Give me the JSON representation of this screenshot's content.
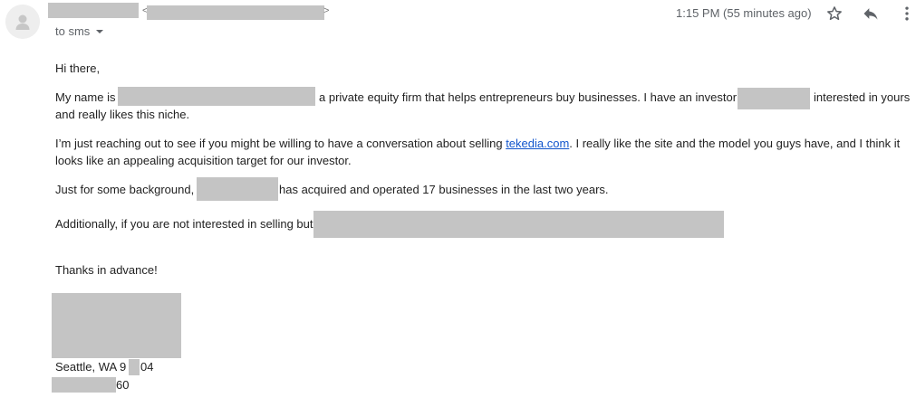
{
  "header": {
    "recipient_label": "to sms",
    "angle_open": "<",
    "angle_close": ">",
    "timestamp": "1:15 PM (55 minutes ago)"
  },
  "email": {
    "greeting": "Hi there,",
    "p1_start": "My name is",
    "p1_mid": "a private equity firm that helps entrepreneurs buy businesses. I have an investor",
    "p1_end": "interested in yours",
    "p1_line2": "and really likes this niche.",
    "p2_start": "I’m just reaching out to see if you might be willing to have a conversation about selling",
    "p2_link": "tekedia.com",
    "p2_end": ". I really like the site and the model you guys have, and I think it",
    "p2_line2": "looks like an appealing acquisition target for our investor.",
    "p3_start": "Just for some background,",
    "p3_end": "has acquired and operated 17 businesses in the last two years.",
    "p4_start": "Additionally, if you are not interested in selling but",
    "closing": "Thanks in advance!",
    "address_a": "Seattle, WA 9",
    "address_b": "04",
    "phone_tail": "60"
  },
  "colors": {
    "link": "#1155cc",
    "redaction": "#c4c4c4",
    "meta_text": "#5f6368"
  },
  "icons": {
    "star": "star-icon",
    "reply": "reply-icon",
    "more": "more-vert-icon",
    "avatar": "person-icon"
  }
}
